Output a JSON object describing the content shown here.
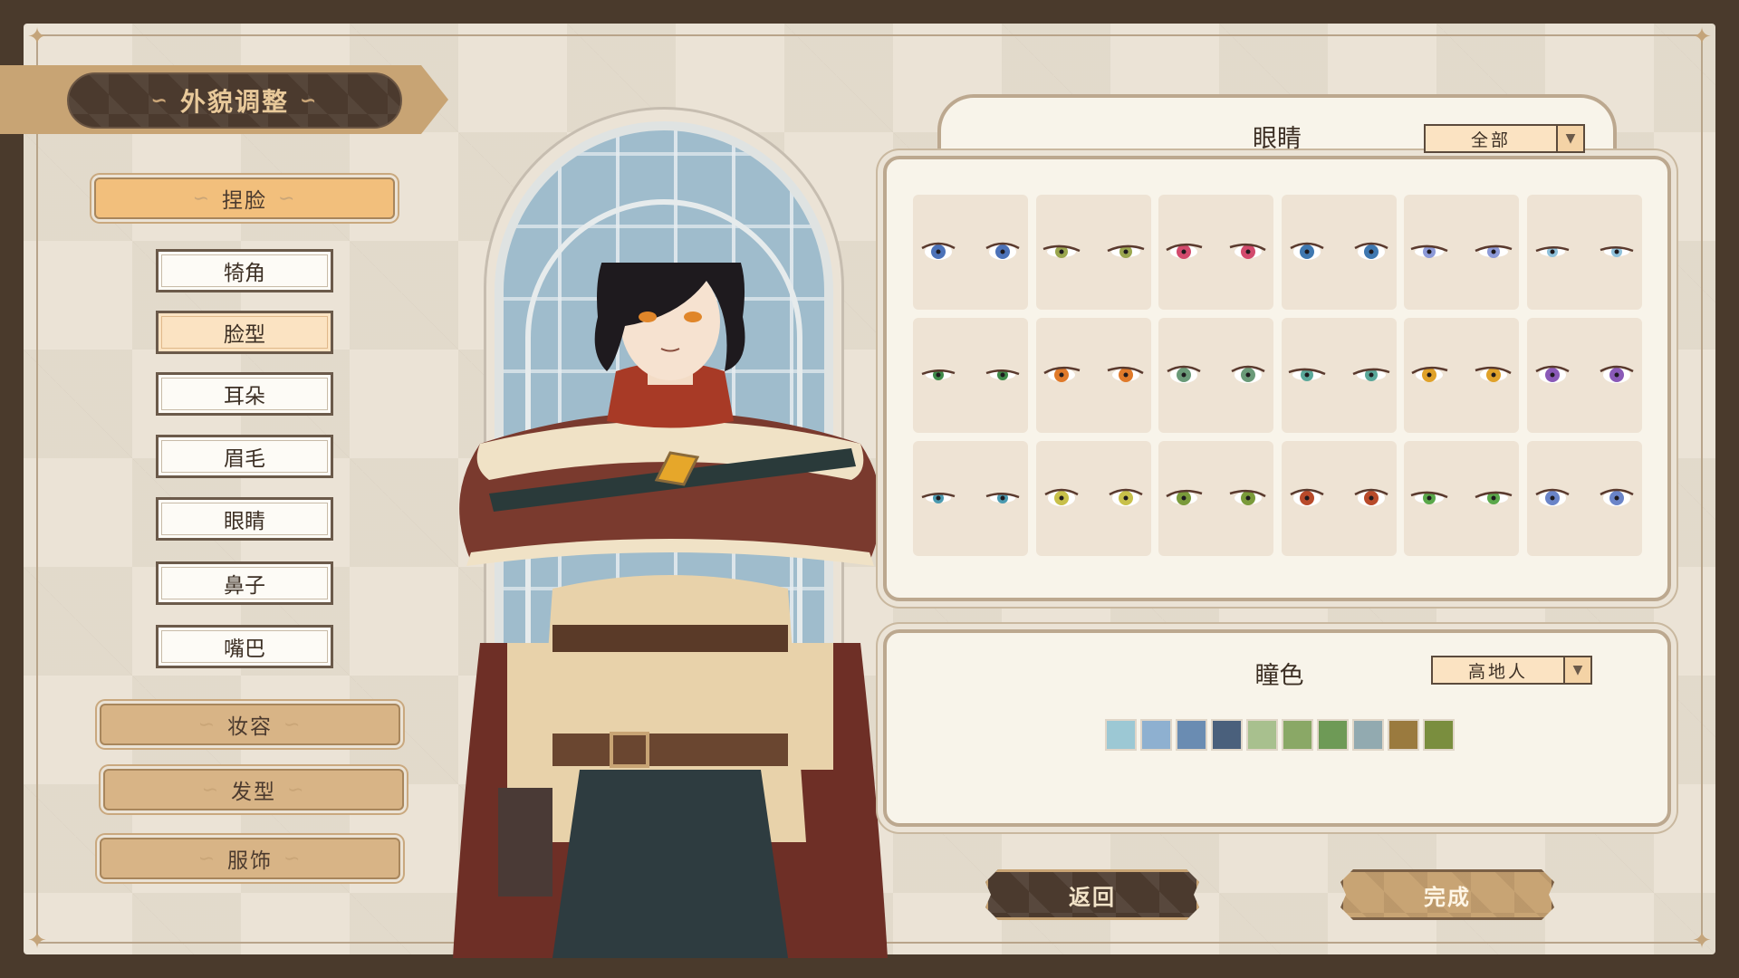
{
  "title": "外貌调整",
  "categories": {
    "face": "捏脸",
    "makeup": "妆容",
    "hair": "发型",
    "clothing": "服饰"
  },
  "face_subitems": [
    "犄角",
    "脸型",
    "耳朵",
    "眉毛",
    "眼睛",
    "鼻子",
    "嘴巴"
  ],
  "selected_subitem": "脸型",
  "eye_panel": {
    "title": "眼睛",
    "filter": "全部",
    "options": [
      {
        "iris": "#4c72b8",
        "style": "round"
      },
      {
        "iris": "#9aa64e",
        "style": "narrow"
      },
      {
        "iris": "#d24a6c",
        "style": "almond"
      },
      {
        "iris": "#3f78b0",
        "style": "round"
      },
      {
        "iris": "#8d9ad8",
        "style": "narrow"
      },
      {
        "iris": "#8fc1da",
        "style": "thin"
      },
      {
        "iris": "#3f8a4a",
        "style": "thin"
      },
      {
        "iris": "#e07a2a",
        "style": "almond"
      },
      {
        "iris": "#6a9a78",
        "style": "round"
      },
      {
        "iris": "#5aa89a",
        "style": "narrow"
      },
      {
        "iris": "#e0a22a",
        "style": "almond"
      },
      {
        "iris": "#8a5ab8",
        "style": "round"
      },
      {
        "iris": "#4a9ab0",
        "style": "thin"
      },
      {
        "iris": "#c8c04a",
        "style": "round"
      },
      {
        "iris": "#7a9a3a",
        "style": "almond"
      },
      {
        "iris": "#b84a2a",
        "style": "round"
      },
      {
        "iris": "#5aa84a",
        "style": "narrow"
      },
      {
        "iris": "#6a84c8",
        "style": "round"
      }
    ]
  },
  "color_panel": {
    "title": "瞳色",
    "filter": "高地人",
    "swatches": [
      "#9cc8d4",
      "#8eb0d0",
      "#6a8cb2",
      "#4a607c",
      "#a8c08e",
      "#8aa866",
      "#6e9a56",
      "#92aab0",
      "#9a7a3e",
      "#7a8e3e"
    ]
  },
  "buttons": {
    "back": "返回",
    "done": "完成"
  }
}
